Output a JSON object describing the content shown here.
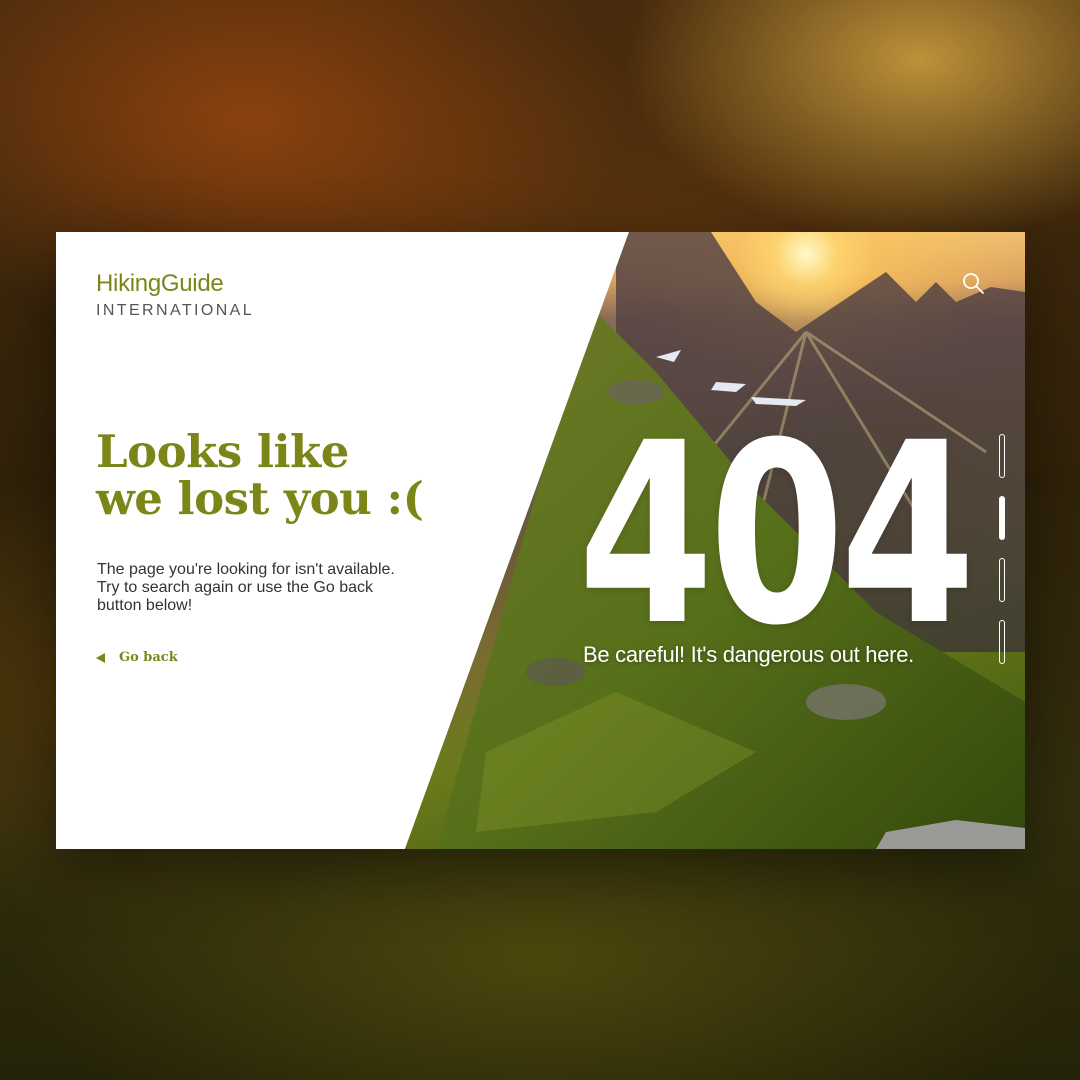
{
  "brand": {
    "name": "HikingGuide",
    "subtitle": "INTERNATIONAL"
  },
  "headline": {
    "line1": "Looks like",
    "line2": "we lost you :("
  },
  "description": {
    "line1": "The page you're looking for isn't available.",
    "line2": "Try to search again or use the Go back",
    "line3": "button below!"
  },
  "go_back": {
    "label": "Go back",
    "icon": "triangle-left-icon"
  },
  "error": {
    "code": "404",
    "tagline": "Be careful! It's dangerous out here."
  },
  "search": {
    "icon": "search-icon"
  },
  "pager": {
    "count": 4,
    "active_index": 1
  },
  "colors": {
    "brand_green": "#7c8618",
    "text_dark": "#333333",
    "white": "#ffffff"
  }
}
